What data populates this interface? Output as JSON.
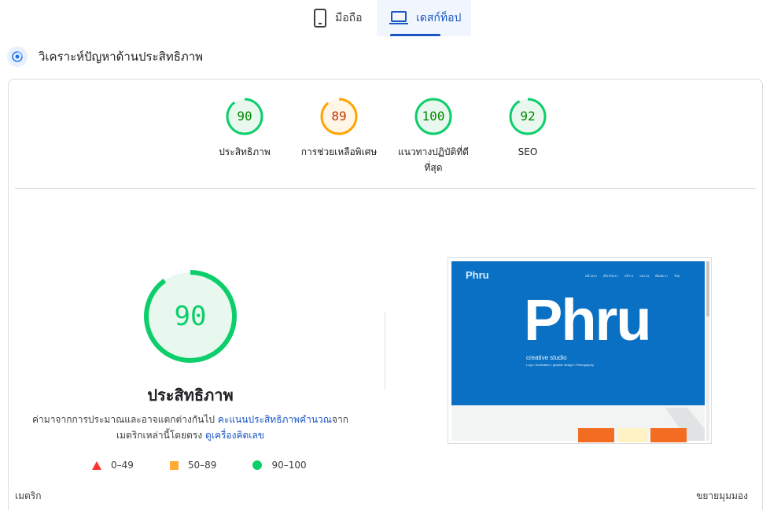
{
  "tabs": {
    "mobile_label": "มือถือ",
    "desktop_label": "เดสก์ท็อป"
  },
  "section": {
    "title": "วิเคราะห์ปัญหาด้านประสิทธิภาพ"
  },
  "summary_gauges": [
    {
      "score": "90",
      "label": "ประสิทธิภาพ",
      "fraction": 0.9,
      "color": "#0cce6b",
      "text_color": "#008800",
      "bg": "#e8f8ee"
    },
    {
      "score": "89",
      "label": "การช่วยเหลือพิเศษ",
      "fraction": 0.89,
      "color": "#ffa400",
      "text_color": "#c33300",
      "bg": "#fff6e8"
    },
    {
      "score": "100",
      "label": "แนวทางปฏิบัติที่ดีที่สุด",
      "fraction": 1.0,
      "color": "#0cce6b",
      "text_color": "#008800",
      "bg": "#e8f8ee"
    },
    {
      "score": "92",
      "label": "SEO",
      "fraction": 0.92,
      "color": "#0cce6b",
      "text_color": "#008800",
      "bg": "#e8f8ee"
    }
  ],
  "main_gauge": {
    "score": "90",
    "fraction": 0.9,
    "color": "#0cce6b",
    "title": "ประสิทธิภาพ"
  },
  "description": {
    "text_before": "ค่ามาจากการประมาณและอาจแตกต่างกันไป ",
    "link1": "คะแนนประสิทธิภาพคำนวณ",
    "text_middle": "จากเมตริกเหล่านี้โดยตรง ",
    "link2": "ดูเครื่องคิดเลข"
  },
  "legend": {
    "fail": "0–49",
    "average": "50–89",
    "pass": "90–100"
  },
  "thumbnail": {
    "logo_small": "Phru",
    "nav": [
      "หน้าแรก",
      "เกี่ยวกับเรา",
      "บริการ",
      "ผลงาน",
      "ติดต่อเรา",
      "ไทย"
    ],
    "logo_big": "Phru",
    "tagline": "creative studio",
    "subline": "Logo / Illustration / graphic design / Photography"
  },
  "footer": {
    "metrics_label": "เมตริก",
    "expand_label": "ขยายมุมมอง"
  }
}
